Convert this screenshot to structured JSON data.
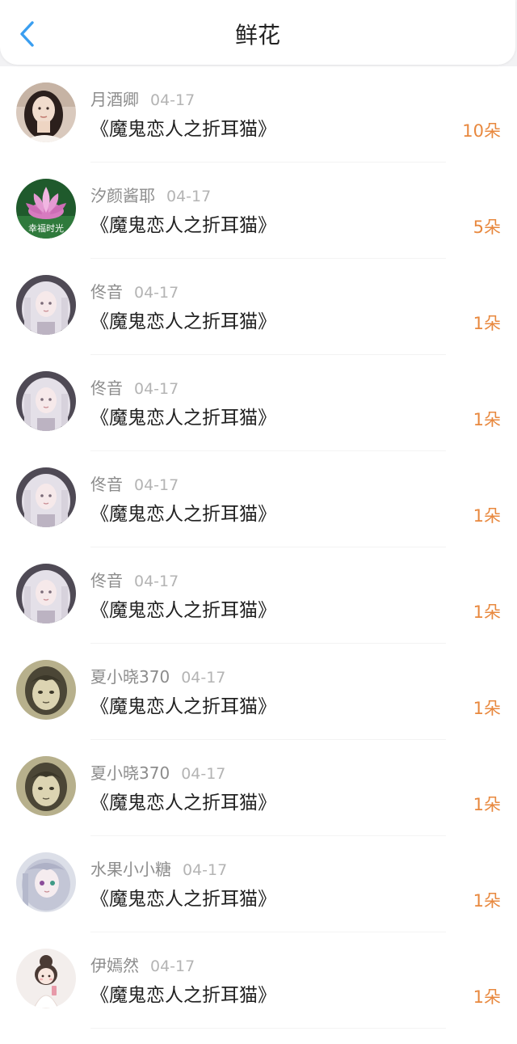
{
  "header": {
    "title": "鲜花",
    "back_icon": "chevron-left-icon",
    "accent_color": "#3a9ef0"
  },
  "colors": {
    "count_color": "#e8883e",
    "name_color": "#8c8c8c",
    "date_color": "#b4b4b4",
    "title_color": "#222222"
  },
  "items": [
    {
      "name": "月酒卿",
      "date": "04-17",
      "book": "《魔鬼恋人之折耳猫》",
      "count": "10朵",
      "avatar": "photo-woman"
    },
    {
      "name": "汐颜酱耶",
      "date": "04-17",
      "book": "《魔鬼恋人之折耳猫》",
      "count": "5朵",
      "avatar": "lotus",
      "avatar_caption": "幸福时光"
    },
    {
      "name": "佟音",
      "date": "04-17",
      "book": "《魔鬼恋人之折耳猫》",
      "count": "1朵",
      "avatar": "anime-white-hair"
    },
    {
      "name": "佟音",
      "date": "04-17",
      "book": "《魔鬼恋人之折耳猫》",
      "count": "1朵",
      "avatar": "anime-white-hair"
    },
    {
      "name": "佟音",
      "date": "04-17",
      "book": "《魔鬼恋人之折耳猫》",
      "count": "1朵",
      "avatar": "anime-white-hair"
    },
    {
      "name": "佟音",
      "date": "04-17",
      "book": "《魔鬼恋人之折耳猫》",
      "count": "1朵",
      "avatar": "anime-white-hair"
    },
    {
      "name": "夏小晓370",
      "date": "04-17",
      "book": "《魔鬼恋人之折耳猫》",
      "count": "1朵",
      "avatar": "sketch-face"
    },
    {
      "name": "夏小晓370",
      "date": "04-17",
      "book": "《魔鬼恋人之折耳猫》",
      "count": "1朵",
      "avatar": "sketch-face"
    },
    {
      "name": "水果小小糖",
      "date": "04-17",
      "book": "《魔鬼恋人之折耳猫》",
      "count": "1朵",
      "avatar": "anime-silver-hair"
    },
    {
      "name": "伊嫣然",
      "date": "04-17",
      "book": "《魔鬼恋人之折耳猫》",
      "count": "1朵",
      "avatar": "chibi-girl"
    }
  ]
}
